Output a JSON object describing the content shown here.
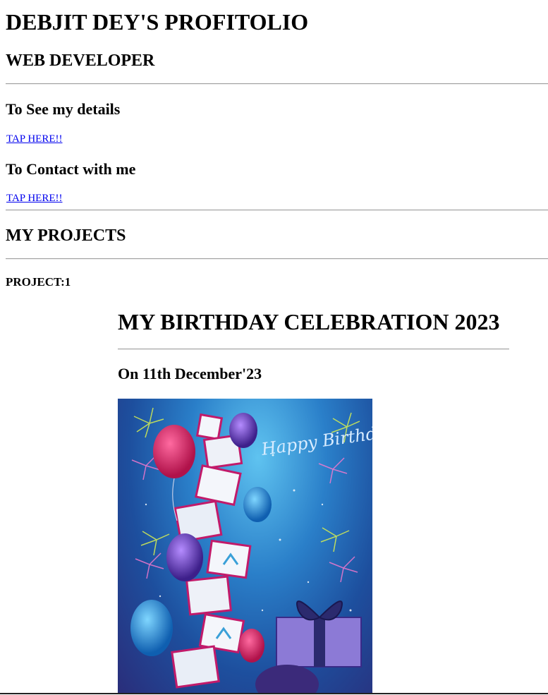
{
  "header": {
    "title": "DEBJIT DEY'S PROFITOLIO",
    "subtitle": "WEB DEVELOPER"
  },
  "details": {
    "heading": "To See my details",
    "link_label": "TAP HERE!!"
  },
  "contact": {
    "heading": "To Contact with me",
    "link_label": "TAP HERE!!"
  },
  "projects": {
    "heading": "MY PROJECTS",
    "items": [
      {
        "label": "PROJECT:1",
        "title": "MY BIRTHDAY CELEBRATION 2023",
        "date": "On 11th December'23",
        "image_text": "Happy Birthday"
      }
    ]
  },
  "colors": {
    "link": "#0000ee",
    "rule": "#a0a0a0"
  }
}
